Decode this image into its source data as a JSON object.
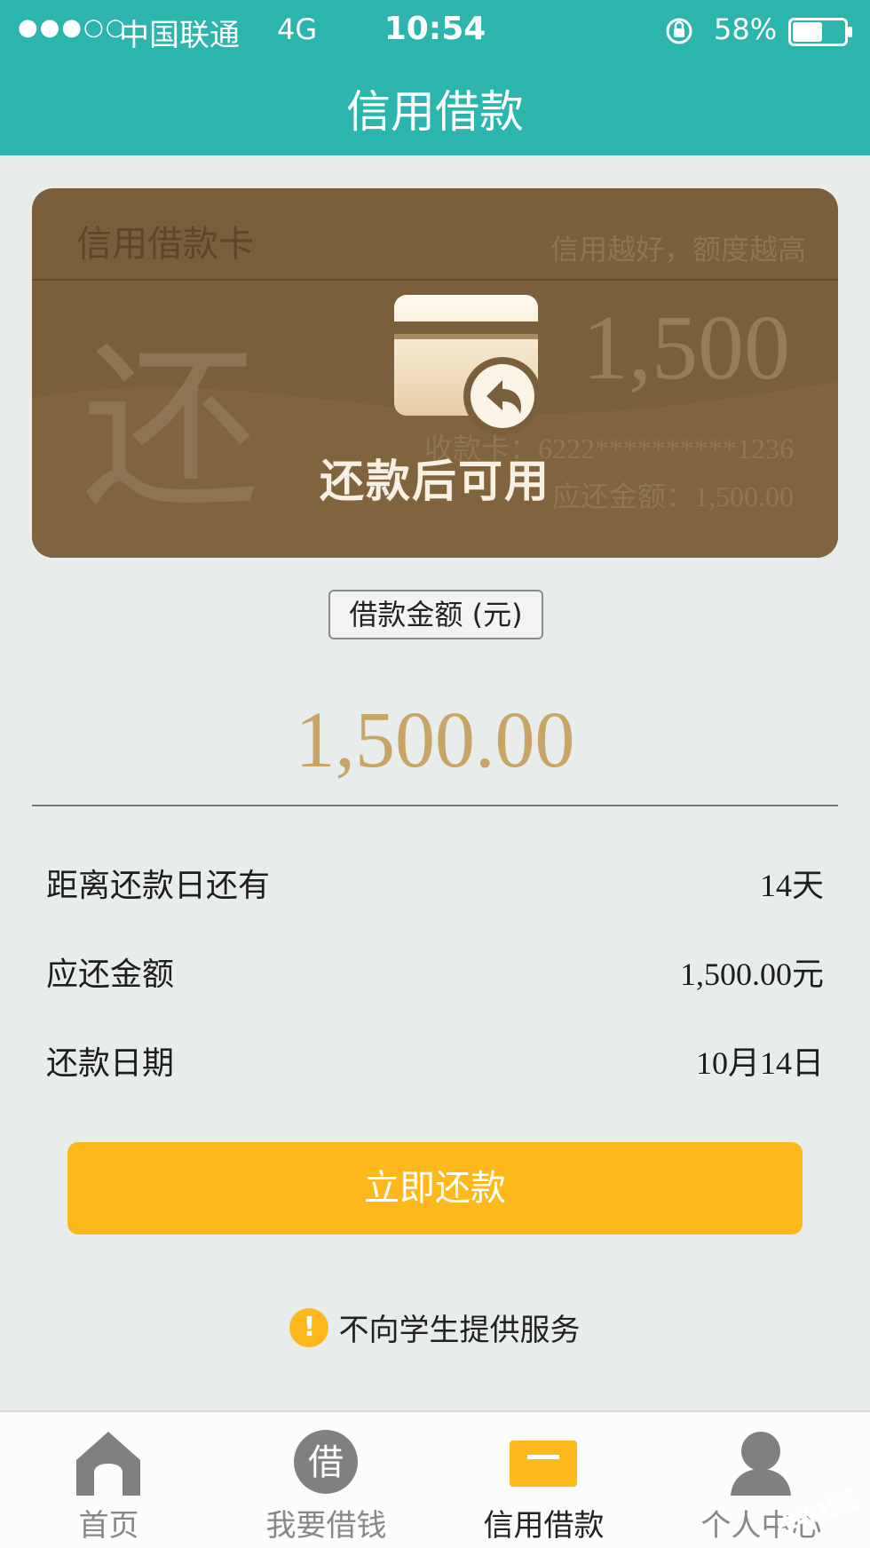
{
  "status_bar": {
    "signal": "●●●○○",
    "carrier": "中国联通",
    "network": "4G",
    "time": "10:54",
    "battery": "58%",
    "battery_level": 0.58
  },
  "nav": {
    "title": "信用借款"
  },
  "card": {
    "title": "信用借款卡",
    "slogan": "信用越好，额度越高",
    "big_char": "还",
    "limit": "1,500",
    "card_number": "收款卡：6222**********1236",
    "due_amount": "应还金额：1,500.00",
    "overlay_text": "还款后可用"
  },
  "loan": {
    "label": "借款金额 (元)",
    "amount": "1,500.00"
  },
  "details": [
    {
      "label": "距离还款日还有",
      "value": "14天"
    },
    {
      "label": "应还金额",
      "value": "1,500.00元"
    },
    {
      "label": "还款日期",
      "value": "10月14日"
    }
  ],
  "actions": {
    "repay": "立即还款"
  },
  "notice": {
    "icon": "!",
    "text": "不向学生提供服务"
  },
  "tabbar": [
    {
      "label": "首页",
      "icon": "home-icon"
    },
    {
      "label": "我要借钱",
      "icon": "borrow-icon",
      "glyph": "借"
    },
    {
      "label": "信用借款",
      "icon": "credit-card-icon"
    },
    {
      "label": "个人中心",
      "icon": "user-icon"
    }
  ],
  "watermark": {
    "text": "卡农社区"
  },
  "colors": {
    "header": "#2bb5ad",
    "card": "#7a5f3c",
    "accent": "#fdb81c",
    "amount": "#c9a565",
    "tab_inactive": "#888888"
  }
}
